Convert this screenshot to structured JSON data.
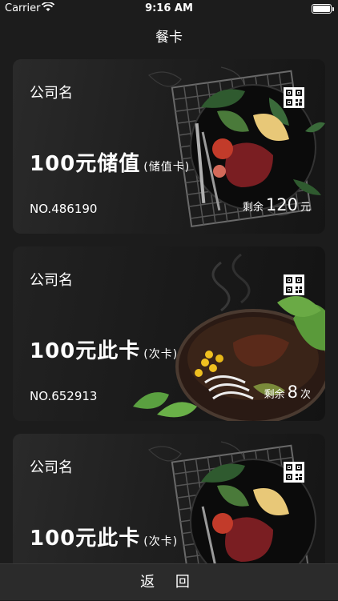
{
  "status_bar": {
    "carrier": "Carrier",
    "time": "9:16 AM"
  },
  "nav": {
    "title": "餐卡"
  },
  "cards": [
    {
      "company": "公司名",
      "title_main": "100元储值",
      "title_sub": "(储值卡)",
      "number": "NO.486190",
      "remain_prefix": "剩余",
      "remain_value": "120",
      "remain_unit": "元"
    },
    {
      "company": "公司名",
      "title_main": "100元此卡",
      "title_sub": "(次卡)",
      "number": "NO.652913",
      "remain_prefix": "剩余",
      "remain_value": "8",
      "remain_unit": "次"
    },
    {
      "company": "公司名",
      "title_main": "100元此卡",
      "title_sub": "(次卡)"
    }
  ],
  "footer": {
    "back_label": "返 回"
  }
}
